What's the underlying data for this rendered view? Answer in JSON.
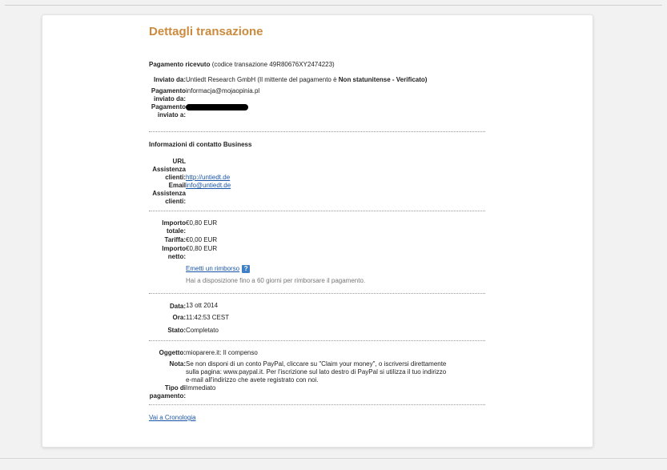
{
  "title": "Dettagli transazione",
  "payment": {
    "heading": "Pagamento ricevuto",
    "tx_code": "(codice transazione 49R80676XY2474223)",
    "sent_by_label": "Inviato da:",
    "sent_by_value": "Untiedt Research GmbH (Il mittente del pagamento è",
    "sent_by_status": "Non statunitense - Verificato)",
    "payment_sent_from_label": "Pagamento inviato da:",
    "payment_sent_from_value": "informacja@mojaopinia.pl",
    "payment_sent_to_label": "Pagamento inviato a:"
  },
  "business": {
    "heading": "Informazioni di contatto Business",
    "url_label": "URL Assistenza clienti:",
    "url_value": "http://untiedt.de",
    "email_label": "Email Assistenza clienti:",
    "email_value": "info@untiedt.de"
  },
  "amounts": {
    "total_label": "Importo totale:",
    "total_value": "€0,80 EUR",
    "fee_label": "Tariffa:",
    "fee_value": "€0,00 EUR",
    "net_label": "Importo netto:",
    "net_value": "€0,80 EUR",
    "refund_link": "Emetti un rimborso",
    "refund_help": "?",
    "refund_note": "Hai a disposizione fino a 60 giorni per rimborsare il pagamento."
  },
  "details": {
    "date_label": "Data:",
    "date_value": "13 ott 2014",
    "time_label": "Ora:",
    "time_value": "11:42:53 CEST",
    "status_label": "Stato:",
    "status_value": "Completato"
  },
  "extra": {
    "subject_label": "Oggetto:",
    "subject_value": "mioparere.it: Il compenso",
    "note_label": "Nota:",
    "note_value": "Se non disponi di un conto PayPal, cliccare su \"Claim your money\", o iscriversi direttamente sulla pagina: www.paypal.it. Per l'iscrizione sul lato destro di PayPal si utilizza il tuo indirizzo e-mail all'indirizzo che avete registrato con noi.",
    "type_label": "Tipo di pagamento:",
    "type_value": "Immediato"
  },
  "footer": {
    "history_link": "Vai a Cronologia"
  }
}
